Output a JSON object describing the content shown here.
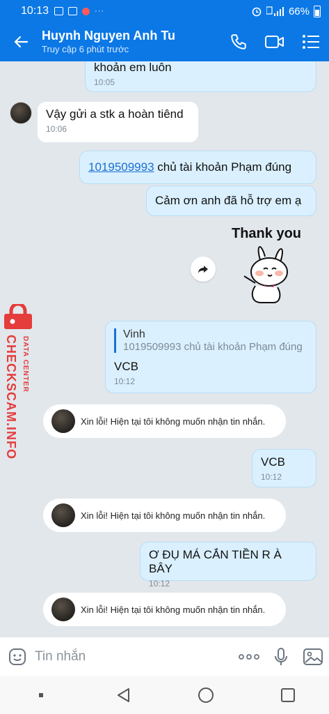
{
  "status_bar": {
    "time": "10:13",
    "battery": "66%",
    "more": "···"
  },
  "header": {
    "contact_name": "Huynh Nguyen Anh Tu",
    "last_seen": "Truy cập 6 phút trước"
  },
  "messages": {
    "m1": {
      "text": "khoản em luôn",
      "time": "10:05"
    },
    "m2": {
      "text": "Vậy gửi a stk a hoàn tiênd",
      "time": "10:06"
    },
    "m3": {
      "account": "1019509993",
      "text": " chủ tài khoản Phạm đúng"
    },
    "m4": {
      "text": "Cảm ơn anh đã hỗ trợ em ạ"
    },
    "sticker": {
      "text": "Thank you"
    },
    "m5": {
      "quote_name": "Vinh",
      "quote_text": "1019509993 chủ tài khoản Phạm đúng",
      "text": "VCB",
      "time": "10:12"
    },
    "sys1": {
      "text": "Xin lỗi! Hiện tại tôi không muốn nhận tin nhắn."
    },
    "m6": {
      "text": "VCB",
      "time": "10:12"
    },
    "sys2": {
      "text": "Xin lỗi! Hiện tại tôi không muốn nhận tin nhắn."
    },
    "m7": {
      "text": "Ơ ĐỤ MÁ CẮN TIỀN R À BÂY",
      "time": "10:12"
    },
    "sys3": {
      "text": "Xin lỗi! Hiện tại tôi không muốn nhận tin nhắn."
    }
  },
  "watermark": {
    "main": "CHECKSCAM.INFO",
    "sub": "DATA CENTER"
  },
  "input": {
    "placeholder": "Tin nhắn"
  },
  "icons": {
    "back": "back-arrow-icon",
    "call": "phone-icon",
    "video": "video-call-icon",
    "menu": "list-menu-icon",
    "emoji": "emoji-icon",
    "more": "more-icon",
    "mic": "microphone-icon",
    "image": "image-icon",
    "share": "share-icon"
  },
  "colors": {
    "brand": "#0b78e6",
    "outgoing_bubble": "#daf0fe",
    "chat_bg": "#e2e7ec",
    "watermark": "#e53c3c"
  }
}
